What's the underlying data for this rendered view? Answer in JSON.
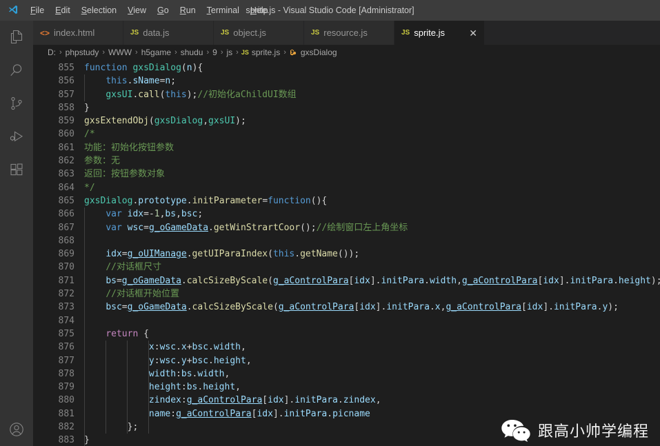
{
  "window": {
    "title": "sprite.js - Visual Studio Code [Administrator]"
  },
  "menu": {
    "items": [
      {
        "label": "File",
        "accel": "F"
      },
      {
        "label": "Edit",
        "accel": "E"
      },
      {
        "label": "Selection",
        "accel": "S"
      },
      {
        "label": "View",
        "accel": "V"
      },
      {
        "label": "Go",
        "accel": "G"
      },
      {
        "label": "Run",
        "accel": "R"
      },
      {
        "label": "Terminal",
        "accel": "T"
      },
      {
        "label": "Help",
        "accel": "H"
      }
    ]
  },
  "activitybar": {
    "items": [
      {
        "name": "explorer-icon",
        "title": "Explorer"
      },
      {
        "name": "search-icon",
        "title": "Search"
      },
      {
        "name": "source-control-icon",
        "title": "Source Control"
      },
      {
        "name": "run-debug-icon",
        "title": "Run and Debug"
      },
      {
        "name": "extensions-icon",
        "title": "Extensions"
      }
    ],
    "account": {
      "name": "account-icon",
      "title": "Accounts"
    }
  },
  "tabs": [
    {
      "label": "index.html",
      "icon": "html",
      "icon_text": "<>",
      "active": false
    },
    {
      "label": "data.js",
      "icon": "js",
      "icon_text": "JS",
      "active": false
    },
    {
      "label": "object.js",
      "icon": "js",
      "icon_text": "JS",
      "active": false
    },
    {
      "label": "resource.js",
      "icon": "js",
      "icon_text": "JS",
      "active": false
    },
    {
      "label": "sprite.js",
      "icon": "js",
      "icon_text": "JS",
      "active": true,
      "close": "✕"
    }
  ],
  "breadcrumb": {
    "separator": "›",
    "items": [
      {
        "label": "D:",
        "icon": null
      },
      {
        "label": "phpstudy",
        "icon": null
      },
      {
        "label": "WWW",
        "icon": null
      },
      {
        "label": "h5game",
        "icon": null
      },
      {
        "label": "shudu",
        "icon": null
      },
      {
        "label": "9",
        "icon": null
      },
      {
        "label": "js",
        "icon": null
      },
      {
        "label": "sprite.js",
        "icon": "js",
        "icon_text": "JS"
      },
      {
        "label": "gxsDialog",
        "icon": "sym",
        "icon_text": "⬚"
      }
    ]
  },
  "editor": {
    "language": "javascript",
    "first_line": 855,
    "last_line": 883,
    "line_numbers": [
      855,
      856,
      857,
      858,
      859,
      860,
      861,
      862,
      863,
      864,
      865,
      866,
      867,
      868,
      869,
      870,
      871,
      872,
      873,
      874,
      875,
      876,
      877,
      878,
      879,
      880,
      881,
      882,
      883
    ],
    "code_lines": [
      "function gxsDialog(n){",
      "    this.sName=n;",
      "    gxsUI.call(this);//初始化aChildUI数组",
      "}",
      "gxsExtendObj(gxsDialog,gxsUI);",
      "/*",
      "功能：初始化按钮参数",
      "参数：无",
      "返回：按钮参数对象",
      "*/",
      "gxsDialog.prototype.initParameter=function(){",
      "    var idx=-1,bs,bsc;",
      "    var wsc=g_oGameData.getWinStrartCoor();//绘制窗口左上角坐标",
      "",
      "    idx=g_oUIManage.getUIParaIndex(this.getName());",
      "    //对话框尺寸",
      "    bs=g_oGameData.calcSizeByScale(g_aControlPara[idx].initPara.width,g_aControlPara[idx].initPara.height);",
      "    //对话框开始位置",
      "    bsc=g_oGameData.calcSizeByScale(g_aControlPara[idx].initPara.x,g_aControlPara[idx].initPara.y);",
      "",
      "    return {",
      "            x:wsc.x+bsc.width,",
      "            y:wsc.y+bsc.height,",
      "            width:bs.width,",
      "            height:bs.height,",
      "            zindex:g_aControlPara[idx].initPara.zindex,",
      "            name:g_aControlPara[idx].initPara.picname",
      "        };",
      "}"
    ]
  },
  "watermark": {
    "text": "跟高小帅学编程",
    "logo": "wechat-logo"
  },
  "colors": {
    "titlebar_bg": "#3c3c3c",
    "activitybar_bg": "#333333",
    "tabbar_bg": "#252526",
    "tab_inactive_bg": "#2d2d2d",
    "editor_bg": "#1e1e1e",
    "keyword": "#569cd6",
    "control_keyword": "#c586c0",
    "type": "#4ec9b0",
    "function": "#dcdcaa",
    "variable": "#9cdcfe",
    "number": "#b5cea8",
    "comment": "#6a9955",
    "text": "#d4d4d4",
    "line_number": "#858585",
    "js_icon": "#cbcb41",
    "html_icon": "#e37933",
    "symbol_icon": "#e8a33d"
  }
}
